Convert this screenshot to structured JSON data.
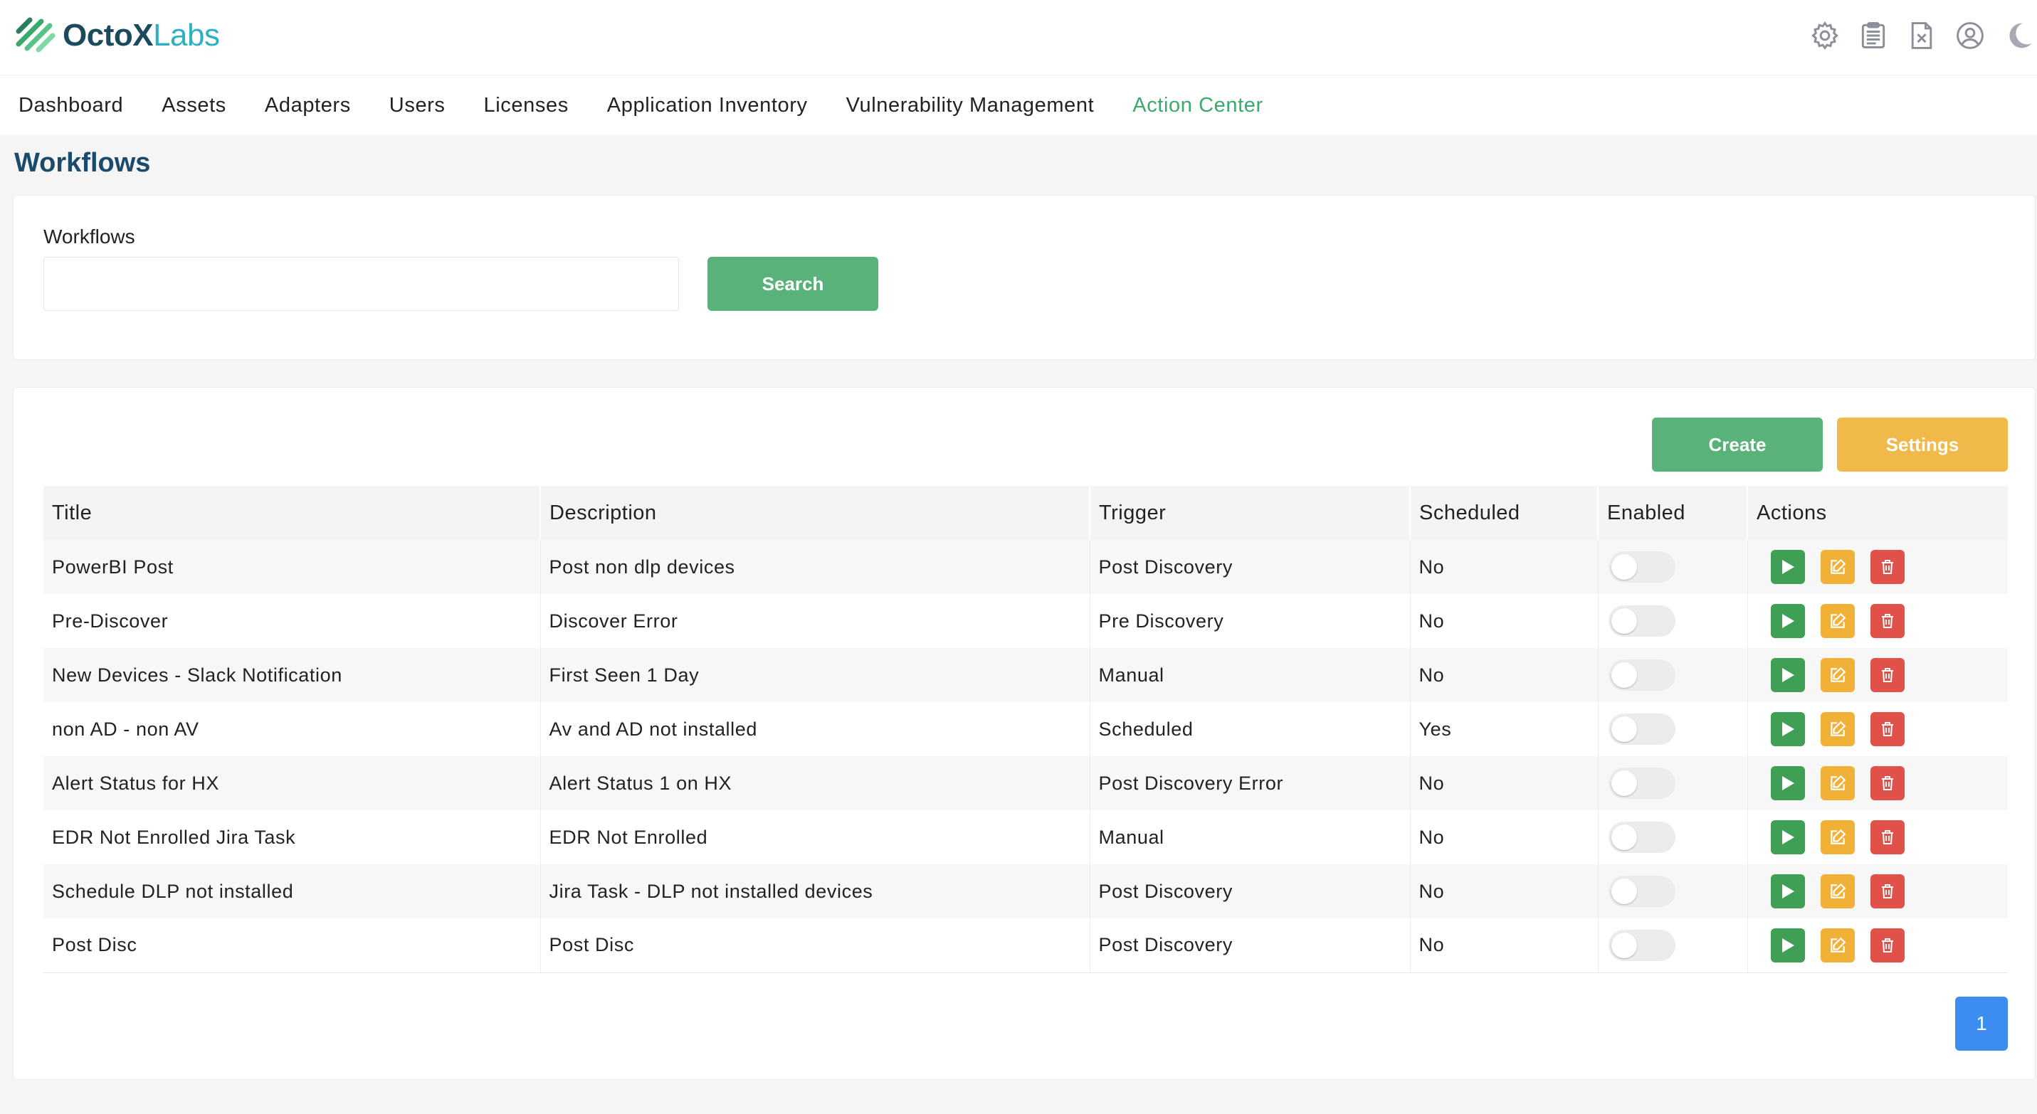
{
  "brand": {
    "name_bold": "OctoX",
    "name_light": "Labs",
    "accent": "#3aaa6a"
  },
  "header_icons": [
    "gear-icon",
    "clipboard-icon",
    "document-x-icon",
    "user-circle-icon",
    "moon-icon"
  ],
  "nav": {
    "items": [
      "Dashboard",
      "Assets",
      "Adapters",
      "Users",
      "Licenses",
      "Application Inventory",
      "Vulnerability Management",
      "Action Center"
    ],
    "active": "Action Center"
  },
  "page": {
    "title": "Workflows"
  },
  "search": {
    "label": "Workflows",
    "value": "",
    "placeholder": "",
    "button": "Search"
  },
  "toolbar": {
    "create": "Create",
    "settings": "Settings"
  },
  "table": {
    "columns": [
      "Title",
      "Description",
      "Trigger",
      "Scheduled",
      "Enabled",
      "Actions"
    ],
    "rows": [
      {
        "title": "PowerBI Post",
        "description": "Post non dlp devices",
        "trigger": "Post Discovery",
        "scheduled": "No",
        "enabled": false
      },
      {
        "title": "Pre-Discover",
        "description": "Discover Error",
        "trigger": "Pre Discovery",
        "scheduled": "No",
        "enabled": false
      },
      {
        "title": "New Devices - Slack Notification",
        "description": "First Seen 1 Day",
        "trigger": "Manual",
        "scheduled": "No",
        "enabled": false
      },
      {
        "title": "non AD - non AV",
        "description": "Av and AD not installed",
        "trigger": "Scheduled",
        "scheduled": "Yes",
        "enabled": false
      },
      {
        "title": "Alert Status for HX",
        "description": "Alert Status 1 on HX",
        "trigger": "Post Discovery Error",
        "scheduled": "No",
        "enabled": false
      },
      {
        "title": "EDR Not Enrolled Jira Task",
        "description": "EDR Not Enrolled",
        "trigger": "Manual",
        "scheduled": "No",
        "enabled": false
      },
      {
        "title": "Schedule DLP not installed",
        "description": "Jira Task - DLP not installed devices",
        "trigger": "Post Discovery",
        "scheduled": "No",
        "enabled": false
      },
      {
        "title": "Post Disc",
        "description": "Post Disc",
        "trigger": "Post Discovery",
        "scheduled": "No",
        "enabled": false
      }
    ],
    "action_icons": [
      "play-icon",
      "edit-icon",
      "trash-icon"
    ]
  },
  "pagination": {
    "current": "1"
  },
  "colors": {
    "green": "#59b27a",
    "orange": "#f1b84a",
    "red": "#e0514a",
    "blue": "#3d8cf0",
    "title_navy": "#1b4a6a"
  }
}
